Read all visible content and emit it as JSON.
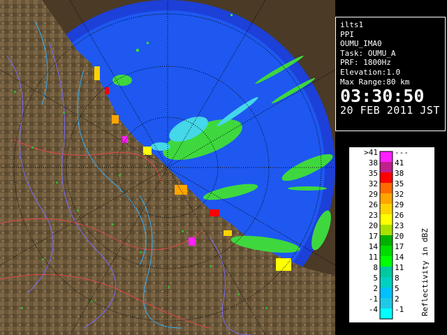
{
  "info": {
    "site": "ilts1",
    "mode": "PPI",
    "product": "OUMU_IMA0",
    "task": "Task: OUMU_A",
    "prf": "PRF: 1800Hz",
    "elevation": "Elevation:1.0",
    "max_range": "Max Range:80 km",
    "time": "03:30:50",
    "date": "20 FEB 2011 JST"
  },
  "legend": {
    "title": "Reflectivity in dBZ",
    "rows": [
      {
        "left": ">41",
        "right": "---",
        "color": "#ff1fff"
      },
      {
        "left": "38",
        "right": "41",
        "color": "#c0208c"
      },
      {
        "left": "35",
        "right": "38",
        "color": "#ff0000"
      },
      {
        "left": "32",
        "right": "35",
        "color": "#ff6a00"
      },
      {
        "left": "29",
        "right": "32",
        "color": "#ffa500"
      },
      {
        "left": "26",
        "right": "29",
        "color": "#ffd300"
      },
      {
        "left": "23",
        "right": "26",
        "color": "#ffff00"
      },
      {
        "left": "20",
        "right": "23",
        "color": "#a8e000"
      },
      {
        "left": "17",
        "right": "20",
        "color": "#00b000"
      },
      {
        "left": "14",
        "right": "17",
        "color": "#00dc00"
      },
      {
        "left": "11",
        "right": "14",
        "color": "#00ff00"
      },
      {
        "left": "8",
        "right": "11",
        "color": "#00c8a0"
      },
      {
        "left": "5",
        "right": "8",
        "color": "#00d0c0"
      },
      {
        "left": "2",
        "right": "5",
        "color": "#00c0ff"
      },
      {
        "left": "-1",
        "right": "2",
        "color": "#20c8e8"
      },
      {
        "left": "-4",
        "right": "-1",
        "color": "#00ffff"
      }
    ]
  },
  "colors": {
    "sea_inner": "#1e58f0",
    "sea_outer": "#1c40d8",
    "land": "#6e5a3c",
    "echo_green": "#3ed83e",
    "echo_cyan": "#44d8e8",
    "range_ring": "#000000"
  }
}
